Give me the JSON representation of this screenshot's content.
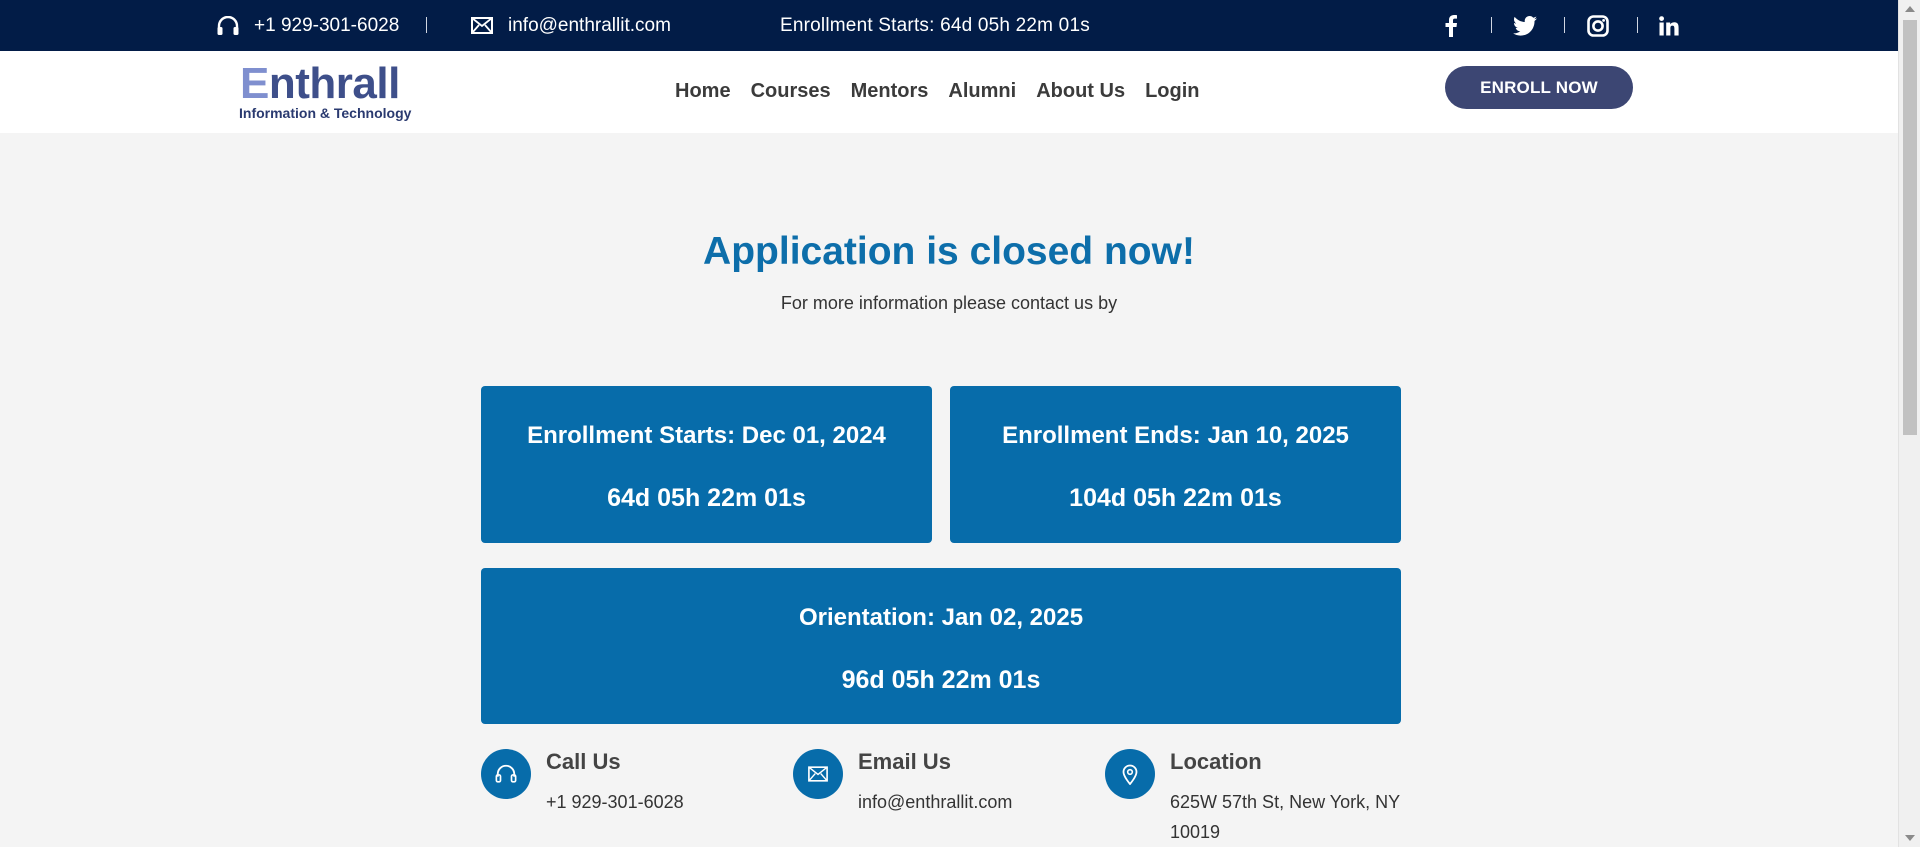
{
  "topbar": {
    "phone": "+1 929-301-6028",
    "email": "info@enthrallit.com",
    "countdown": "Enrollment Starts: 64d 05h 22m 01s",
    "social": [
      "facebook-icon",
      "twitter-icon",
      "instagram-icon",
      "linkedin-icon"
    ]
  },
  "header": {
    "logo_word": "nthrall",
    "logo_letter": "E",
    "logo_tagline": "Information & Technology",
    "nav": [
      "Home",
      "Courses",
      "Mentors",
      "Alumni",
      "About Us",
      "Login"
    ],
    "enroll_label": "ENROLL NOW"
  },
  "main": {
    "heading": "Application is closed now!",
    "subheading": "For more information please contact us by",
    "cards": [
      {
        "title": "Enrollment Starts: Dec 01, 2024",
        "timer": "64d 05h 22m 01s"
      },
      {
        "title": "Enrollment Ends: Jan 10, 2025",
        "timer": "104d 05h 22m 01s"
      },
      {
        "title": "Orientation: Jan 02, 2025",
        "timer": "96d 05h 22m 01s"
      }
    ],
    "contacts": [
      {
        "title": "Call Us",
        "value": "+1 929-301-6028",
        "icon": "headset-icon"
      },
      {
        "title": "Email Us",
        "value": "info@enthrallit.com",
        "icon": "envelope-icon"
      },
      {
        "title": "Location",
        "value": "625W 57th St, New York, NY 10019",
        "icon": "location-pin-icon"
      }
    ]
  },
  "colors": {
    "topbar_bg": "#021c47",
    "accent_blue": "#076caa",
    "heading_blue": "#0d6eaa",
    "button_bg": "#3c4673"
  }
}
